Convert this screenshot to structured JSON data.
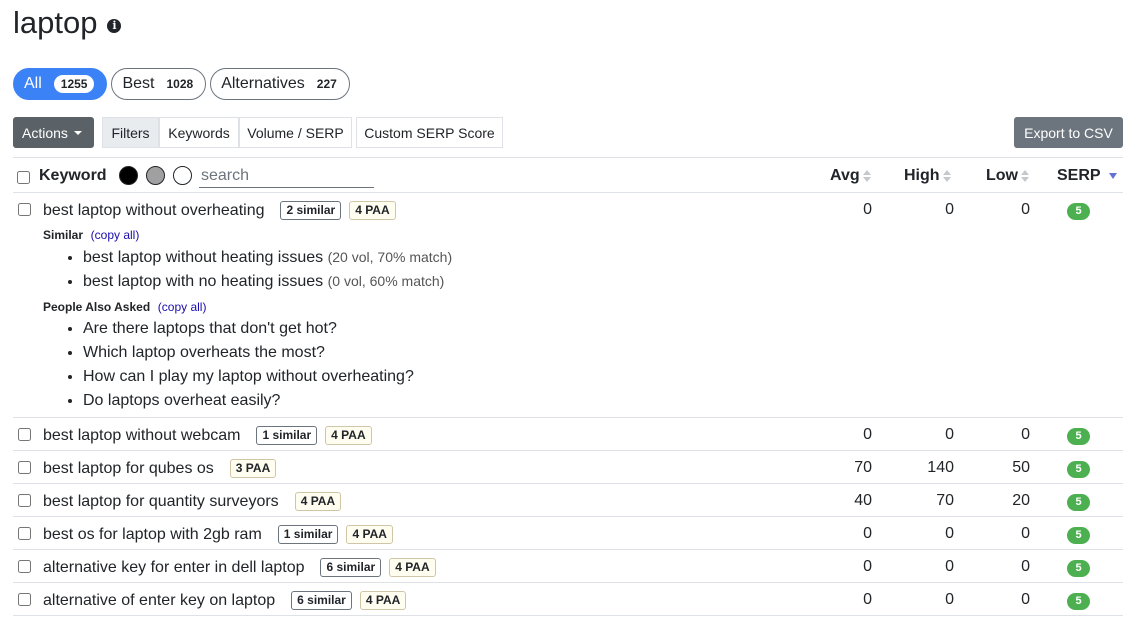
{
  "page": {
    "title": "laptop"
  },
  "tabs": [
    {
      "label": "All",
      "count": "1255"
    },
    {
      "label": "Best",
      "count": "1028"
    },
    {
      "label": "Alternatives",
      "count": "227"
    }
  ],
  "toolbar": {
    "actions_label": "Actions",
    "filters_label": "Filters",
    "keywords_label": "Keywords",
    "volume_serp_label": "Volume / SERP",
    "custom_serp_label": "Custom SERP Score",
    "export_label": "Export to CSV"
  },
  "table": {
    "keyword_header": "Keyword",
    "search_placeholder": "search",
    "avg_header": "Avg",
    "high_header": "High",
    "low_header": "Low",
    "serp_header": "SERP",
    "rows": [
      {
        "keyword": "best laptop without overheating",
        "similar": "2 similar",
        "paa": "4 PAA",
        "avg": "0",
        "high": "0",
        "low": "0",
        "serp": "5",
        "details": {
          "similar_label": "Similar",
          "copy_all": "(copy all)",
          "similar_items": [
            {
              "text": "best laptop without heating issues",
              "meta": "(20 vol, 70% match)"
            },
            {
              "text": "best laptop with no heating issues",
              "meta": "(0 vol, 60% match)"
            }
          ],
          "paa_label": "People Also Asked",
          "paa_copy_all": "(copy all)",
          "paa_items": [
            "Are there laptops that don't get hot?",
            "Which laptop overheats the most?",
            "How can I play my laptop without overheating?",
            "Do laptops overheat easily?"
          ]
        }
      },
      {
        "keyword": "best laptop without webcam",
        "similar": "1 similar",
        "paa": "4 PAA",
        "avg": "0",
        "high": "0",
        "low": "0",
        "serp": "5"
      },
      {
        "keyword": "best laptop for qubes os",
        "similar": "",
        "paa": "3 PAA",
        "avg": "70",
        "high": "140",
        "low": "50",
        "serp": "5"
      },
      {
        "keyword": "best laptop for quantity surveyors",
        "similar": "",
        "paa": "4 PAA",
        "avg": "40",
        "high": "70",
        "low": "20",
        "serp": "5"
      },
      {
        "keyword": "best os for laptop with 2gb ram",
        "similar": "1 similar",
        "paa": "4 PAA",
        "avg": "0",
        "high": "0",
        "low": "0",
        "serp": "5"
      },
      {
        "keyword": "alternative key for enter in dell laptop",
        "similar": "6 similar",
        "paa": "4 PAA",
        "avg": "0",
        "high": "0",
        "low": "0",
        "serp": "5"
      },
      {
        "keyword": "alternative of enter key on laptop",
        "similar": "6 similar",
        "paa": "4 PAA",
        "avg": "0",
        "high": "0",
        "low": "0",
        "serp": "5"
      }
    ]
  },
  "colors": {
    "accent": "#3b82f6",
    "serp_badge": "#4caf50",
    "dark_button": "#5a6268"
  }
}
